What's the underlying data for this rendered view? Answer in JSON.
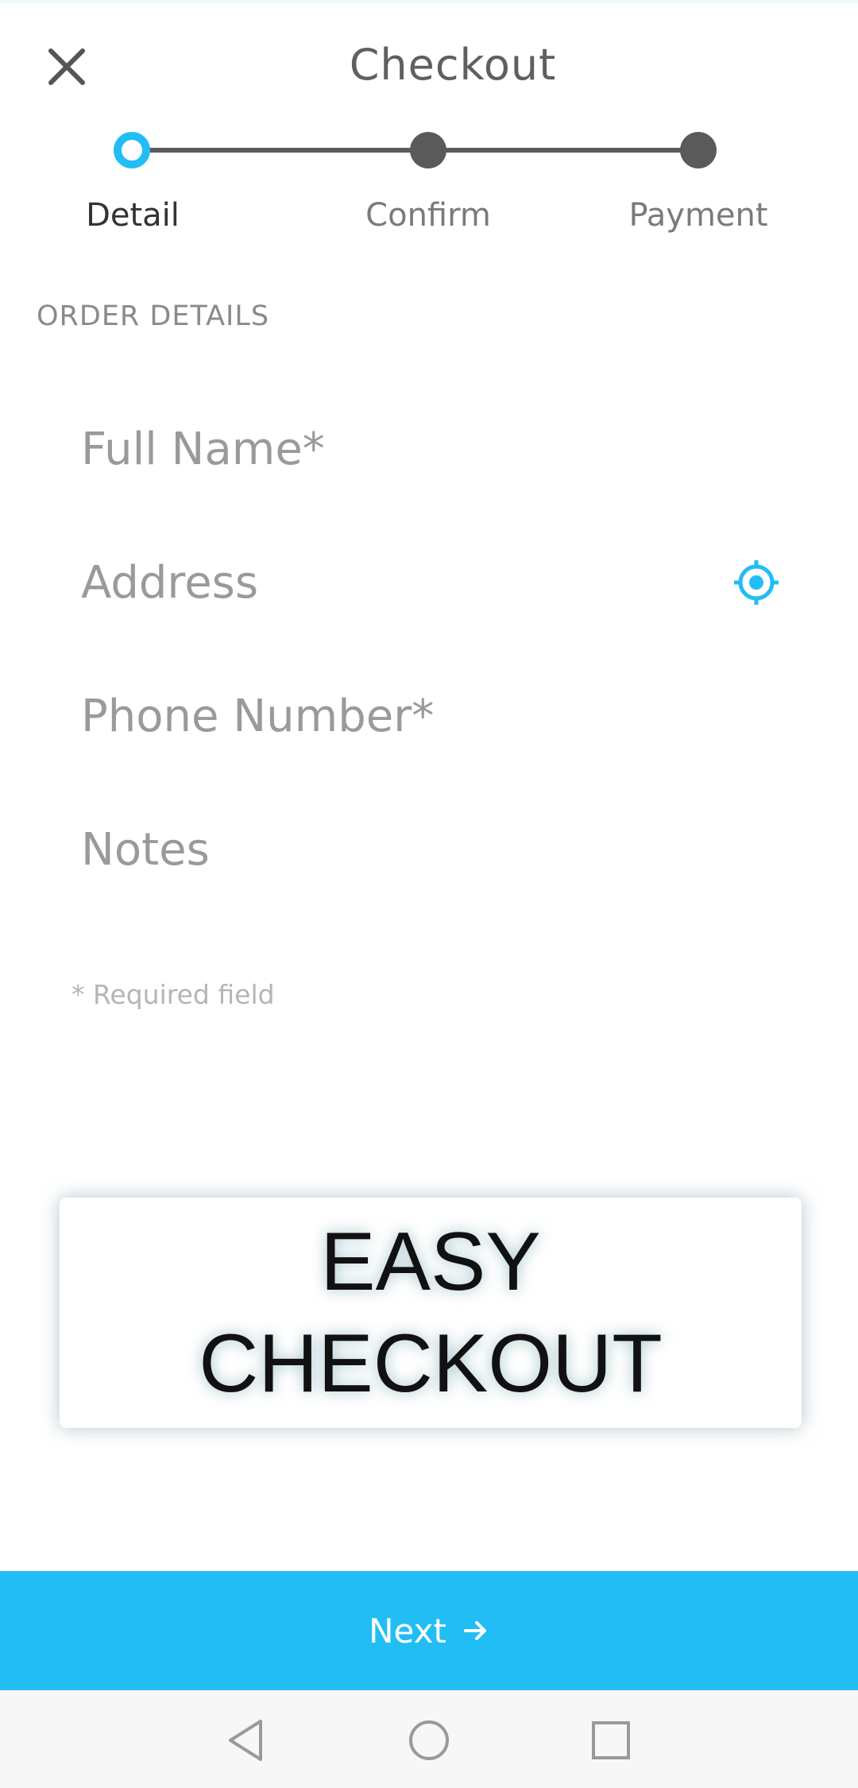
{
  "header": {
    "title": "Checkout",
    "close_icon": "close-icon"
  },
  "stepper": {
    "steps": [
      {
        "label": "Detail",
        "state": "active"
      },
      {
        "label": "Confirm",
        "state": "pending"
      },
      {
        "label": "Payment",
        "state": "pending"
      }
    ],
    "active_color": "#22bdf5",
    "pending_color": "#5a5a5a"
  },
  "form": {
    "section_title": "ORDER DETAILS",
    "full_name": {
      "placeholder": "Full Name*",
      "value": ""
    },
    "address": {
      "placeholder": "Address",
      "value": "",
      "icon": "location-target-icon"
    },
    "phone": {
      "placeholder": "Phone Number*",
      "value": ""
    },
    "notes": {
      "placeholder": "Notes",
      "value": ""
    },
    "required_note": "* Required field"
  },
  "promo": {
    "line1": "EASY",
    "line2": "CHECKOUT"
  },
  "footer": {
    "next_label": "Next",
    "next_icon": "arrow-right-icon",
    "accent_color": "#22bdf5"
  },
  "navbar": {
    "buttons": [
      "back-icon",
      "home-icon",
      "recents-icon"
    ]
  }
}
